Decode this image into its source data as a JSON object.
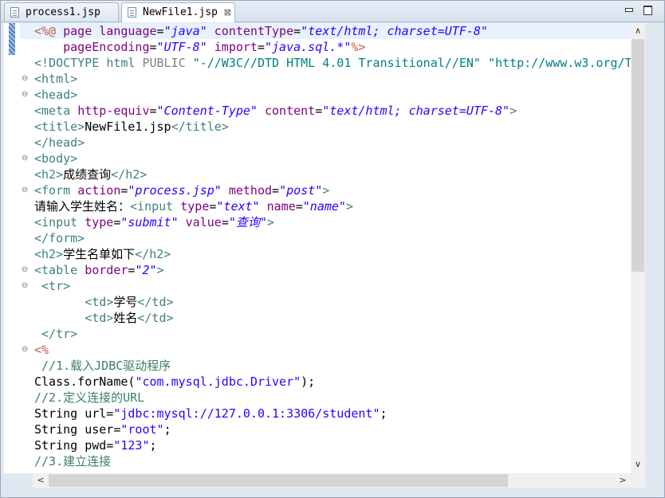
{
  "tabs": [
    {
      "label": "process1.jsp",
      "active": false
    },
    {
      "label": "NewFile1.jsp",
      "active": true,
      "close": "⊠"
    }
  ],
  "scroll": {
    "up": "∧",
    "down": "∨",
    "left": "<",
    "right": ">"
  },
  "code_lines": [
    {
      "fold": "",
      "html": "<span class=\"dl\">&lt;%@</span> <span class=\"an\">page</span> <span class=\"an\">language</span>=<span class=\"av\">\"java\"</span> <span class=\"an\">contentType</span>=<span class=\"av\">\"text/html; charset=UTF-8\"</span>"
    },
    {
      "fold": "",
      "html": "    <span class=\"an\">pageEncoding</span>=<span class=\"av\">\"UTF-8\"</span> <span class=\"an\">import</span>=<span class=\"av\">\"java.sql.*\"</span><span class=\"dl\">%&gt;</span>"
    },
    {
      "fold": "",
      "html": "<span class=\"tag\">&lt;!DOCTYPE</span> <span class=\"tag\">html</span> <span class=\"dg\">PUBLIC</span> <span class=\"dt\">\"-//W3C//DTD HTML 4.01 Transitional//EN\"</span> <span class=\"dt\">\"http://www.w3.org/T</span>"
    },
    {
      "fold": "⊖",
      "html": "<span class=\"tag\">&lt;html&gt;</span>"
    },
    {
      "fold": "⊖",
      "html": "<span class=\"tag\">&lt;head&gt;</span>"
    },
    {
      "fold": "",
      "html": "<span class=\"tag\">&lt;meta</span> <span class=\"an\">http-equiv</span>=<span class=\"av\">\"Content-Type\"</span> <span class=\"an\">content</span>=<span class=\"av\">\"text/html; charset=UTF-8\"</span><span class=\"tag\">&gt;</span>"
    },
    {
      "fold": "",
      "html": "<span class=\"tag\">&lt;title&gt;</span>NewFile1.jsp<span class=\"tag\">&lt;/title&gt;</span>"
    },
    {
      "fold": "",
      "html": "<span class=\"tag\">&lt;/head&gt;</span>"
    },
    {
      "fold": "⊖",
      "html": "<span class=\"tag\">&lt;body&gt;</span>"
    },
    {
      "fold": "",
      "html": "<span class=\"tag\">&lt;h2&gt;</span>成绩查询<span class=\"tag\">&lt;/h2&gt;</span>"
    },
    {
      "fold": "⊖",
      "html": "<span class=\"tag\">&lt;form</span> <span class=\"an\">action</span>=<span class=\"av\">\"process.jsp\"</span> <span class=\"an\">method</span>=<span class=\"av\">\"post\"</span><span class=\"tag\">&gt;</span>"
    },
    {
      "fold": "",
      "html": "请输入学生姓名：<span class=\"tag\">&lt;input</span> <span class=\"an\">type</span>=<span class=\"av\">\"text\"</span> <span class=\"an\">name</span>=<span class=\"av\">\"name\"</span><span class=\"tag\">&gt;</span>"
    },
    {
      "fold": "",
      "html": "<span class=\"tag\">&lt;input</span> <span class=\"an\">type</span>=<span class=\"av\">\"submit\"</span> <span class=\"an\">value</span>=<span class=\"av\">\"查询\"</span><span class=\"tag\">&gt;</span>"
    },
    {
      "fold": "",
      "html": "<span class=\"tag\">&lt;/form&gt;</span>"
    },
    {
      "fold": "",
      "html": "<span class=\"tag\">&lt;h2&gt;</span>学生名单如下<span class=\"tag\">&lt;/h2&gt;</span>"
    },
    {
      "fold": "⊖",
      "html": "<span class=\"tag\">&lt;table</span> <span class=\"an\">border</span>=<span class=\"av\">\"2\"</span><span class=\"tag\">&gt;</span>"
    },
    {
      "fold": "⊖",
      "html": " <span class=\"tag\">&lt;tr&gt;</span>"
    },
    {
      "fold": "",
      "html": "       <span class=\"tag\">&lt;td&gt;</span>学号<span class=\"tag\">&lt;/td&gt;</span>"
    },
    {
      "fold": "",
      "html": "       <span class=\"tag\">&lt;td&gt;</span>姓名<span class=\"tag\">&lt;/td&gt;</span>"
    },
    {
      "fold": "",
      "html": " <span class=\"tag\">&lt;/tr&gt;</span>"
    },
    {
      "fold": "⊖",
      "html": "<span class=\"dl\">&lt;%</span>"
    },
    {
      "fold": "",
      "html": " <span class=\"cm\">//1.载入JDBC驱动程序</span>"
    },
    {
      "fold": "",
      "html": "Class.forName(<span class=\"st\">\"com.mysql.jdbc.Driver\"</span>);"
    },
    {
      "fold": "",
      "html": "<span class=\"cm\">//2.定义连接的URL</span>"
    },
    {
      "fold": "",
      "html": "String url=<span class=\"st\">\"jdbc:mysql://127.0.0.1:3306/student\"</span>;"
    },
    {
      "fold": "",
      "html": "String user=<span class=\"st\">\"root\"</span>;"
    },
    {
      "fold": "",
      "html": "String pwd=<span class=\"st\">\"123\"</span>;"
    },
    {
      "fold": "",
      "html": "<span class=\"cm\">//3.建立连接</span>"
    }
  ]
}
